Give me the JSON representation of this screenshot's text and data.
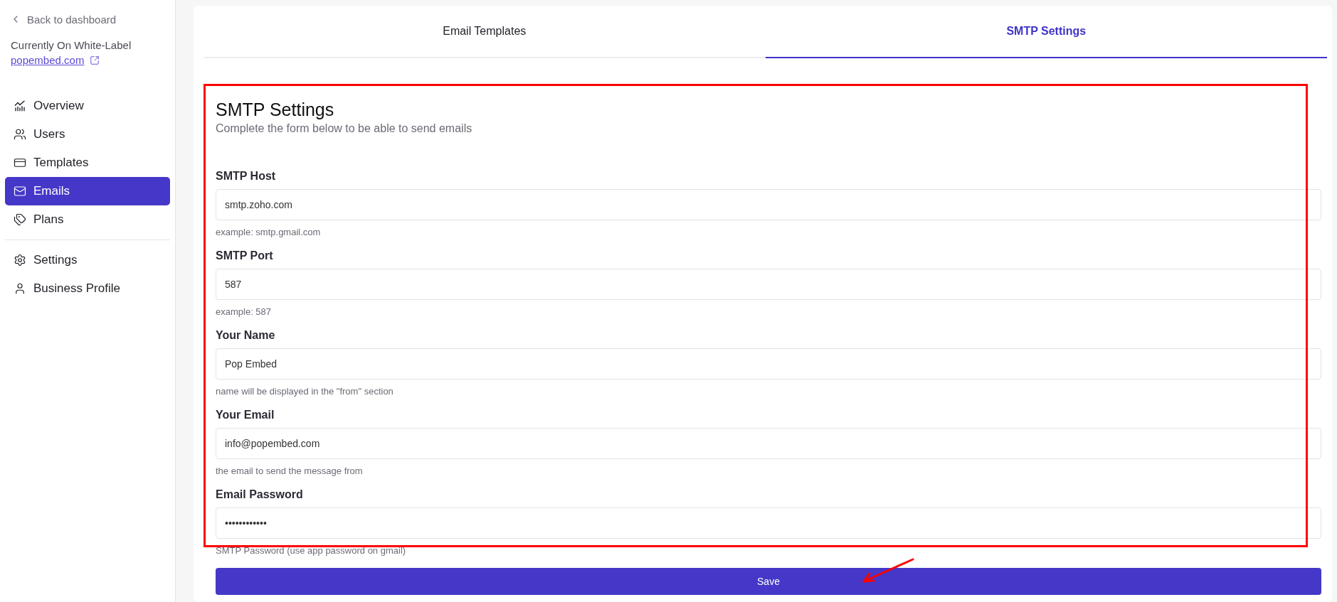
{
  "sidebar": {
    "back_link": "Back to dashboard",
    "white_label_caption": "Currently On White-Label",
    "white_label_link": "popembed.com",
    "items": [
      {
        "kind": "overview",
        "label": "Overview",
        "selected": false
      },
      {
        "kind": "users",
        "label": "Users",
        "selected": false
      },
      {
        "kind": "templates",
        "label": "Templates",
        "selected": false
      },
      {
        "kind": "emails",
        "label": "Emails",
        "selected": true
      },
      {
        "kind": "plans",
        "label": "Plans",
        "selected": false
      },
      {
        "kind": "divider"
      },
      {
        "kind": "settings",
        "label": "Settings",
        "selected": false
      },
      {
        "kind": "profile",
        "label": "Business Profile",
        "selected": false
      }
    ]
  },
  "tabs": [
    {
      "label": "Email Templates",
      "selected": false
    },
    {
      "label": "SMTP Settings",
      "selected": true
    }
  ],
  "form": {
    "title": "SMTP Settings",
    "subtitle": "Complete the form below to be able to send emails",
    "fields": [
      {
        "label": "SMTP Host",
        "value": "smtp.zoho.com",
        "help": "example: smtp.gmail.com"
      },
      {
        "label": "SMTP Port",
        "value": "587",
        "help": "example: 587"
      },
      {
        "label": "Your Name",
        "value": "Pop Embed",
        "help": "name will be displayed in the \"from\" section"
      },
      {
        "label": "Your Email",
        "value": "info@popembed.com",
        "help": "the email to send the message from"
      },
      {
        "label": "Email Password",
        "value": "••••••••••••",
        "help": "SMTP Password (use app password on gmail)"
      }
    ],
    "save_button": "Save"
  }
}
